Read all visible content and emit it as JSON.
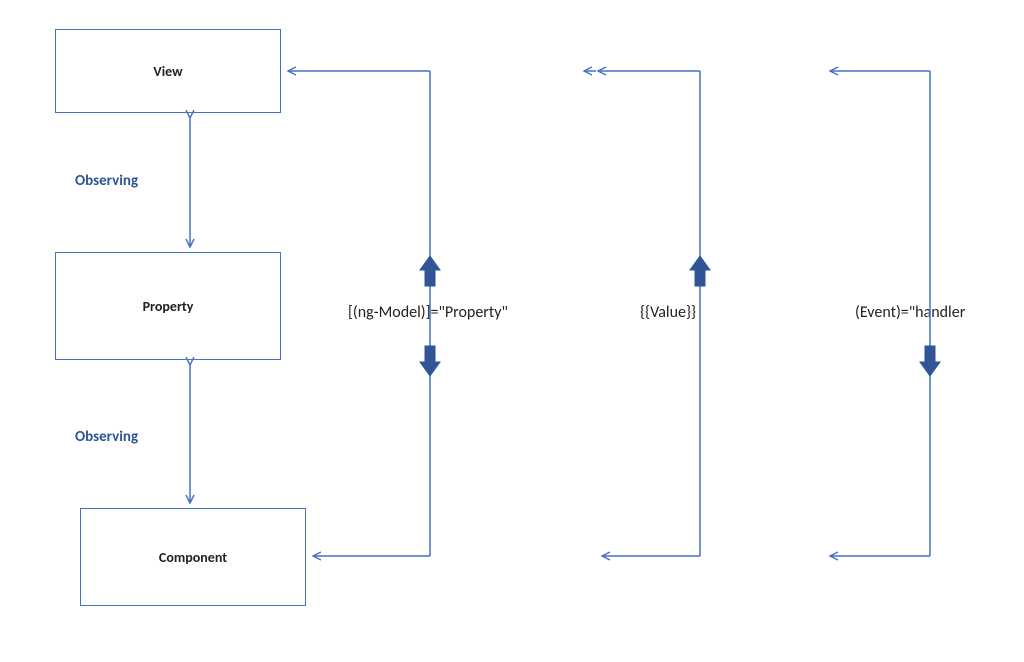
{
  "boxes": {
    "view": "View",
    "property": "Property",
    "component": "Component"
  },
  "labels": {
    "observing1": "Observing",
    "observing2": "Observing",
    "col1": "[(ng-Model)]=\"Property\"",
    "col2": "{{Value}}",
    "col3": "(Event)=\"handler"
  },
  "colors": {
    "line": "#4472C4",
    "fill": "#2F5597"
  }
}
